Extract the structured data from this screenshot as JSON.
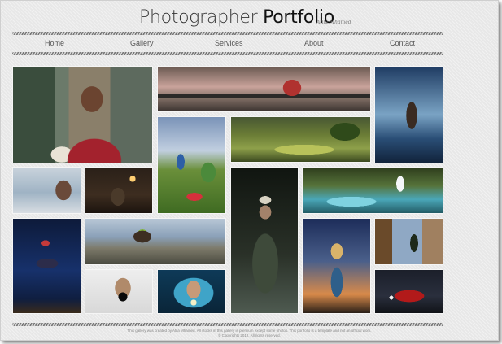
{
  "header": {
    "title_light": "Photographer",
    "title_bold": "Portfolio",
    "author": "Atila Mhamed"
  },
  "nav": {
    "items": [
      "Home",
      "Gallery",
      "Services",
      "About",
      "Contact"
    ]
  },
  "gallery": {
    "photos": [
      "photo-soccer-player-ball",
      "photo-sprinter-pier-sunset",
      "photo-runner-blue-water",
      "photo-boys-playing-field",
      "photo-golf-course-landscape",
      "photo-woman-sea-closeup",
      "photo-man-reading-lamp",
      "photo-waterfall-pools",
      "photo-fisherman-waders",
      "photo-high-jumper-night",
      "photo-rock-climbers-valley",
      "photo-girl-desert-dusk",
      "photo-traffic-light-buildings",
      "photo-photographer-camera",
      "photo-girl-hands-sparkle",
      "photo-red-car-night"
    ]
  },
  "footer": {
    "line1": "This gallery was created by Atila Mhamed. All stocks in this gallery is premium except some photos. This portfolio is a template and not an official work.",
    "line2": "©  Copyrights 2012. All rights reserved."
  },
  "colors": {
    "background": "#ececec",
    "rope": "#777777",
    "nav_text": "#555555",
    "title_text": "#2b2b2b"
  }
}
